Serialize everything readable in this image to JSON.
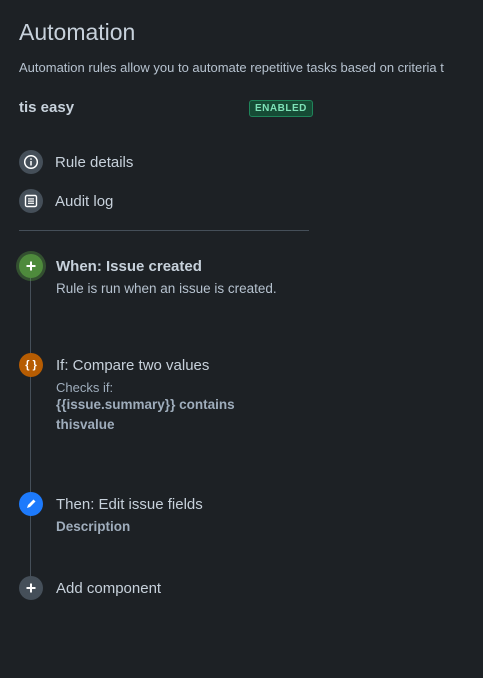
{
  "header": {
    "title": "Automation",
    "subtitle": "Automation rules allow you to automate repetitive tasks based on criteria t"
  },
  "rule": {
    "name": "tis easy",
    "status": "ENABLED"
  },
  "nav": {
    "items": [
      {
        "label": "Rule details",
        "icon": "info-icon"
      },
      {
        "label": "Audit log",
        "icon": "list-icon"
      }
    ]
  },
  "components": {
    "trigger": {
      "title": "When: Issue created",
      "description": "Rule is run when an issue is created.",
      "icon": "plus-icon"
    },
    "condition": {
      "title": "If: Compare two values",
      "checks_label": "Checks if:",
      "expression_line1": "{{issue.summary}} contains",
      "expression_line2": "thisvalue",
      "icon": "braces-icon"
    },
    "action": {
      "title": "Then: Edit issue fields",
      "field": "Description",
      "icon": "pencil-icon"
    },
    "add": {
      "label": "Add component",
      "icon": "plus-icon"
    }
  },
  "colors": {
    "background": "#1d2125",
    "trigger": "#4e8a3c",
    "condition": "#b65c02",
    "action": "#1d7afc",
    "enabled_badge": "#164b35"
  }
}
